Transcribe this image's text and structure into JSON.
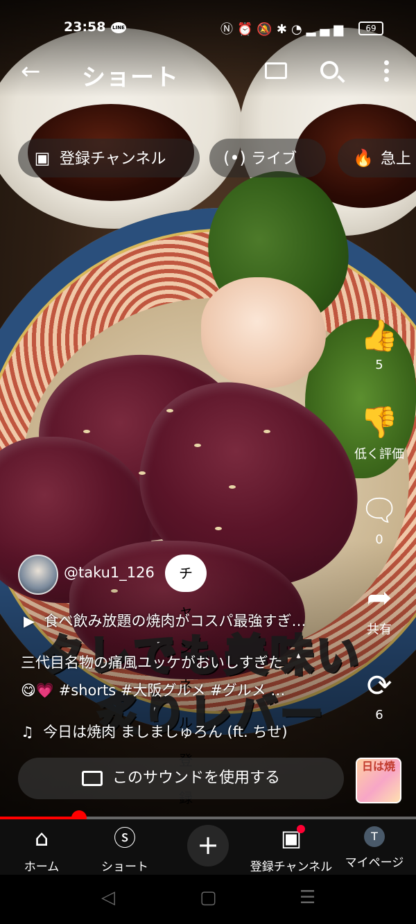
{
  "status_bar": {
    "time": "23:58",
    "line_badge": "LINE",
    "battery": "69"
  },
  "header": {
    "title": "ショート"
  },
  "chips": [
    {
      "label": "登録チャンネル",
      "icon": "subscriptions-icon"
    },
    {
      "label": "ライブ",
      "icon": "live-icon"
    },
    {
      "label": "急上",
      "icon": "trending-icon"
    }
  ],
  "actions": {
    "like_count": "5",
    "dislike_label": "低く評価",
    "comment_count": "0",
    "share_label": "共有",
    "remix_count": "6"
  },
  "video": {
    "channel_handle": "@taku1_126",
    "subscribe_label": "チャンネル登録",
    "playlist_text": "食べ飲み放題の焼肉がコスパ最強すぎ…",
    "description_line1": "三代目名物の痛風ユッケがおいしすぎた",
    "description_line2": "😋💗 #shorts #大阪グルメ #グルメ …",
    "overlay_line1": "タレでも美味い",
    "overlay_line2": "炙りレバー",
    "music_text": "今日は焼肉  ましましゅろん (ft. ちせ)",
    "use_sound_label": "このサウンドを使用する",
    "sound_thumb_text": "日は焼",
    "progress_fraction": 0.19
  },
  "bottom_nav": {
    "items": [
      {
        "label": "ホーム",
        "icon": "home-icon"
      },
      {
        "label": "ショート",
        "icon": "shorts-icon"
      },
      {
        "label": "登録チャンネル",
        "icon": "subscriptions-icon"
      },
      {
        "label": "マイページ",
        "icon": "avatar"
      }
    ],
    "avatar_letter": "T"
  },
  "colors": {
    "accent": "#ff0000",
    "nav_bg": "#0f0f0f"
  }
}
